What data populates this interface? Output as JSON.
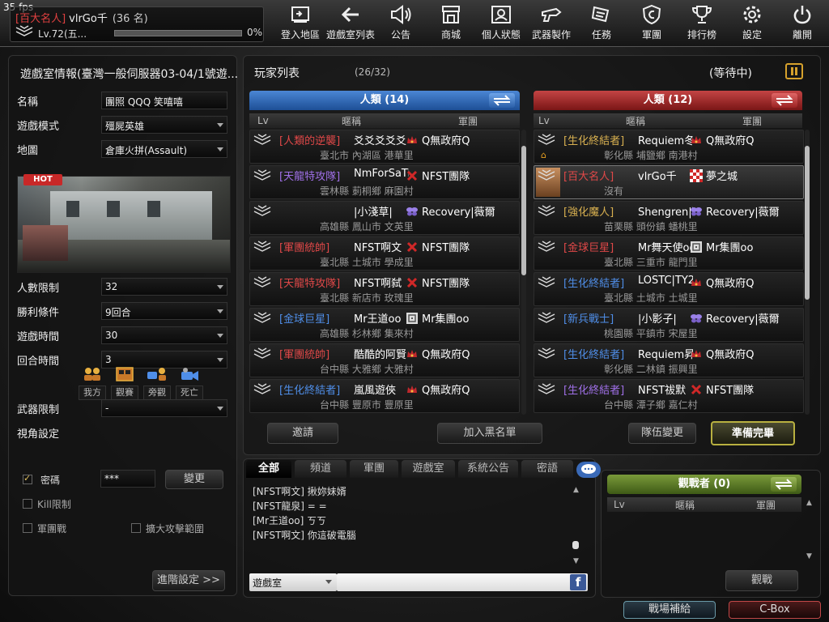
{
  "fps": "35 fps",
  "profile": {
    "tag": "[百大名人]",
    "name": "vlrGo千",
    "rank": "(36 名)",
    "level": "Lv.72(五...",
    "exp_percent": "0%",
    "exp_fraction": 0.0
  },
  "menu": [
    {
      "label": "登入地區",
      "icon": "login-area-icon"
    },
    {
      "label": "遊戲室列表",
      "icon": "back-arrow-icon"
    },
    {
      "label": "公告",
      "icon": "megaphone-icon"
    },
    {
      "label": "商城",
      "icon": "shop-icon"
    },
    {
      "label": "個人狀態",
      "icon": "profile-card-icon"
    },
    {
      "label": "武器製作",
      "icon": "weapon-craft-icon"
    },
    {
      "label": "任務",
      "icon": "mission-icon"
    },
    {
      "label": "軍團",
      "icon": "clan-shield-icon"
    },
    {
      "label": "排行榜",
      "icon": "trophy-icon"
    },
    {
      "label": "設定",
      "icon": "gear-icon"
    },
    {
      "label": "離開",
      "icon": "power-icon"
    }
  ],
  "room": {
    "title": "遊戲室情報(臺灣一般伺服器03-04/1號遊...",
    "name_label": "名稱",
    "name_value": "團照 QQQ 笑嘻嘻",
    "mode_label": "遊戲模式",
    "mode_value": "殭屍英雄",
    "map_label": "地圖",
    "map_value": "倉庫火拼(Assault)",
    "hot": "HOT",
    "players_label": "人數限制",
    "players_value": "32",
    "win_label": "勝利條件",
    "win_value": "9回合",
    "time_label": "遊戲時間",
    "time_value": "30",
    "round_label": "回合時間",
    "round_value": "3",
    "weapon_label": "武器限制",
    "weapon_value": "-",
    "view_label": "視角設定",
    "views": [
      "我方",
      "觀賽",
      "旁觀",
      "死亡"
    ],
    "password_label": "密碼",
    "password_value": "***",
    "change_button": "變更",
    "kill_label": "Kill限制",
    "clan_battle_label": "軍團戰",
    "expand_label": "擴大攻擊範圍",
    "advanced_button": "進階設定 >>"
  },
  "player_list": {
    "title": "玩家列表",
    "count": "(26/32)",
    "status": "(等待中)",
    "columns": {
      "lv": "Lv",
      "nick": "暱稱",
      "clan": "軍團"
    },
    "team_left": {
      "header": "人類 (14)",
      "players": [
        {
          "title": "[人類的逆襲]",
          "title_color": "#e04848",
          "name": "爻爻爻爻爻",
          "clan_icon": "crown",
          "clan": "Q無政府Q",
          "loc": "臺北市 內湖區 港華里"
        },
        {
          "title": "[天龍特攻隊]",
          "title_color": "#a070e8",
          "name": "NmForSaTi",
          "clan_icon": "cross",
          "clan": "NFST團隊",
          "loc": "雲林縣 莿桐鄉 麻園村"
        },
        {
          "title": "",
          "title_color": "#fff",
          "name": "|小淺草|",
          "clan_icon": "butterfly",
          "clan": "Recovery|薇爾",
          "loc": "高雄縣 鳳山市 文英里"
        },
        {
          "title": "[軍團統帥]",
          "title_color": "#e04848",
          "name": "NFST啊文",
          "clan_icon": "cross",
          "clan": "NFST團隊",
          "loc": "臺北縣 土城市 學成里"
        },
        {
          "title": "[天龍特攻隊]",
          "title_color": "#e04848",
          "name": "NFST啊弑",
          "clan_icon": "cross",
          "clan": "NFST團隊",
          "loc": "臺北縣 新店市 玫瑰里"
        },
        {
          "title": "[金球巨星]",
          "title_color": "#4f8ee8",
          "name": "Mr王道oo",
          "clan_icon": "maze",
          "clan": "Mr集團oo",
          "loc": "高雄縣 杉林鄉 集來村"
        },
        {
          "title": "[軍團統帥]",
          "title_color": "#e04848",
          "name": "酷酷的阿賢",
          "clan_icon": "crown",
          "clan": "Q無政府Q",
          "loc": "台中縣 大雅鄉 大雅村"
        },
        {
          "title": "[生化終結者]",
          "title_color": "#4f8ee8",
          "name": "嵐風遊俠",
          "clan_icon": "crown",
          "clan": "Q無政府Q",
          "loc": "台中縣 豐原市 豐原里"
        }
      ]
    },
    "team_right": {
      "header": "人類 (12)",
      "players": [
        {
          "title": "[生化終結者]",
          "title_color": "#d8b050",
          "name": "Requiem冬",
          "clan_icon": "crown",
          "clan": "Q無政府Q",
          "loc": "彰化縣 埔鹽鄉 南港村",
          "host": true
        },
        {
          "title": "[百大名人]",
          "title_color": "#e04848",
          "name": "vlrGo千",
          "clan_icon": "checker",
          "clan": "夢之城",
          "loc": "沒有",
          "me": true
        },
        {
          "title": "[強化魔人]",
          "title_color": "#d8b050",
          "name": "Shengren|豪",
          "clan_icon": "butterfly",
          "clan": "Recovery|薇爾",
          "loc": "苗栗縣 頭份鎮 蟠桃里"
        },
        {
          "title": "[金球巨星]",
          "title_color": "#e04848",
          "name": "Mr舞天使oo",
          "clan_icon": "maze",
          "clan": "Mr集團oo",
          "loc": "臺北縣 三重市 龍門里"
        },
        {
          "title": "[生化終結者]",
          "title_color": "#4f8ee8",
          "name": "LOSTC|TY2",
          "clan_icon": "crown",
          "clan": "Q無政府Q",
          "loc": "臺北縣 土城市 土城里"
        },
        {
          "title": "[新兵戰士]",
          "title_color": "#4f8ee8",
          "name": "|小影子|",
          "clan_icon": "butterfly",
          "clan": "Recovery|薇爾",
          "loc": "桃園縣 平鎮市 宋屋里"
        },
        {
          "title": "[生化終結者]",
          "title_color": "#4f8ee8",
          "name": "Requiem昇",
          "clan_icon": "crown",
          "clan": "Q無政府Q",
          "loc": "彰化縣 二林鎮 振興里"
        },
        {
          "title": "[生化終結者]",
          "title_color": "#a070e8",
          "name": "NFST祓默",
          "clan_icon": "cross",
          "clan": "NFST團隊",
          "loc": "台中縣 潭子鄉 嘉仁村"
        }
      ]
    },
    "buttons": {
      "invite": "邀請",
      "blacklist": "加入黑名單",
      "team_change": "隊伍變更",
      "ready": "準備完畢"
    }
  },
  "chat": {
    "tabs": [
      "全部",
      "頻道",
      "軍團",
      "遊戲室",
      "系統公告",
      "密語"
    ],
    "lines": [
      "[NFST啊文] 揪妳妹婿",
      "[NFST龍泉] = =",
      "[Mr王道oo] ㄎㄎ",
      "[NFST啊文] 你這破電腦"
    ],
    "channel": "遊戲室",
    "input_placeholder": ""
  },
  "spectator": {
    "header": "觀戰者 (0)",
    "columns": {
      "lv": "Lv",
      "nick": "暱稱",
      "clan": "軍團"
    },
    "watch_button": "觀戰"
  },
  "bottom": {
    "supply": "戰場補給",
    "cbox": "C-Box"
  },
  "colors": {
    "team_left": "#2c67b8",
    "team_right": "#a02a2a",
    "gold": "#d6a12c",
    "spectator": "#5a7a2c"
  }
}
